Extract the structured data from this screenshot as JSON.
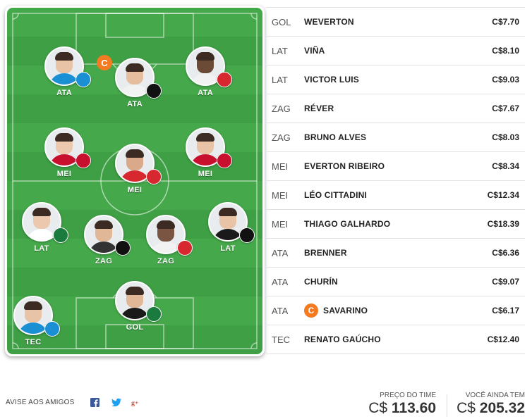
{
  "colors": {
    "field_green": "#45a94b",
    "captain_orange": "#f47b20",
    "facebook": "#3b5998",
    "twitter": "#1da1f2",
    "google_plus": "#dd4b39"
  },
  "field": {
    "players": [
      {
        "id": "ata1",
        "pos": "ATA",
        "club_icon": "gremio-crest-icon",
        "club_color": "#1a8fd4",
        "skin": "#e8c3a6",
        "shirt": "#1a8fd4"
      },
      {
        "id": "ata2",
        "pos": "ATA",
        "club_icon": "atletico-mg-crest-icon",
        "club_color": "#111111",
        "skin": "#e5bea0",
        "shirt": "#f2f2f2",
        "captain": "C"
      },
      {
        "id": "ata3",
        "pos": "ATA",
        "club_icon": "sao-paulo-crest-icon",
        "club_color": "#d7282f",
        "skin": "#6b4a36",
        "shirt": "#f2f2f2"
      },
      {
        "id": "mei1",
        "pos": "MEI",
        "club_icon": "athletico-pr-crest-icon",
        "club_color": "#c8102e",
        "skin": "#ecc9ae",
        "shirt": "#c8102e"
      },
      {
        "id": "mei2",
        "pos": "MEI",
        "club_icon": "internacional-crest-icon",
        "club_color": "#d7282f",
        "skin": "#d9a989",
        "shirt": "#d7282f"
      },
      {
        "id": "mei3",
        "pos": "MEI",
        "club_icon": "flamengo-crest-icon",
        "club_color": "#c8102e",
        "skin": "#e8c3a6",
        "shirt": "#c8102e"
      },
      {
        "id": "lat1",
        "pos": "LAT",
        "club_icon": "palmeiras-crest-icon",
        "club_color": "#1b7a3e",
        "skin": "#ecc9ae",
        "shirt": "#ffffff"
      },
      {
        "id": "zag1",
        "pos": "ZAG",
        "club_icon": "atletico-mg-crest-icon",
        "club_color": "#111111",
        "skin": "#e0b898",
        "shirt": "#333333"
      },
      {
        "id": "zag2",
        "pos": "ZAG",
        "club_icon": "sao-paulo-crest-icon",
        "club_color": "#d7282f",
        "skin": "#7a5642",
        "shirt": "#f2f2f2"
      },
      {
        "id": "lat2",
        "pos": "LAT",
        "club_icon": "botafogo-crest-icon",
        "club_color": "#111111",
        "skin": "#e8c3a6",
        "shirt": "#1a1a1a"
      },
      {
        "id": "gol",
        "pos": "GOL",
        "club_icon": "palmeiras-crest-icon",
        "club_color": "#1b7a3e",
        "skin": "#e0b898",
        "shirt": "#1a1a1a"
      },
      {
        "id": "tec",
        "pos": "TEC",
        "club_icon": "gremio-crest-icon",
        "club_color": "#1a8fd4",
        "skin": "#e8c3a6",
        "shirt": "#1a8fd4"
      }
    ]
  },
  "roster": [
    {
      "pos": "GOL",
      "name": "WEVERTON",
      "price": "C$7.70"
    },
    {
      "pos": "LAT",
      "name": "VIÑA",
      "price": "C$8.10"
    },
    {
      "pos": "LAT",
      "name": "VICTOR LUIS",
      "price": "C$9.03"
    },
    {
      "pos": "ZAG",
      "name": "RÉVER",
      "price": "C$7.67"
    },
    {
      "pos": "ZAG",
      "name": "BRUNO ALVES",
      "price": "C$8.03"
    },
    {
      "pos": "MEI",
      "name": "EVERTON RIBEIRO",
      "price": "C$8.34"
    },
    {
      "pos": "MEI",
      "name": "LÉO CITTADINI",
      "price": "C$12.34"
    },
    {
      "pos": "MEI",
      "name": "THIAGO GALHARDO",
      "price": "C$18.39"
    },
    {
      "pos": "ATA",
      "name": "BRENNER",
      "price": "C$6.36"
    },
    {
      "pos": "ATA",
      "name": "CHURÍN",
      "price": "C$9.07"
    },
    {
      "pos": "ATA",
      "name": "SAVARINO",
      "price": "C$6.17",
      "captain": "C"
    },
    {
      "pos": "TEC",
      "name": "RENATO GAÚCHO",
      "price": "C$12.40"
    }
  ],
  "footer": {
    "share_label": "AVISE AOS AMIGOS",
    "team_price_label": "PREÇO DO TIME",
    "team_price_currency": "C$",
    "team_price_value": "113.60",
    "remaining_label": "VOCÊ AINDA TEM",
    "remaining_currency": "C$",
    "remaining_value": "205.32"
  }
}
